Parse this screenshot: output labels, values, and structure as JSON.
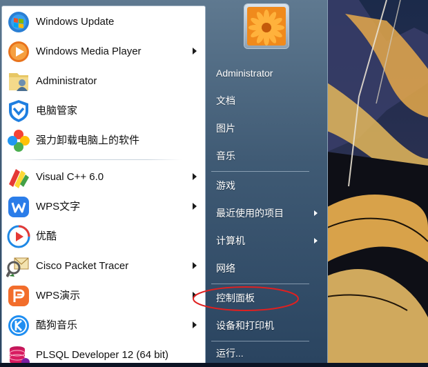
{
  "start_menu": {
    "programs": [
      {
        "label": "Windows Update",
        "icon": "windows-update-icon",
        "has_submenu": false
      },
      {
        "label": "Windows Media Player",
        "icon": "media-player-icon",
        "has_submenu": true
      },
      {
        "label": "Administrator",
        "icon": "user-folder-icon",
        "has_submenu": false
      },
      {
        "label": "电脑管家",
        "icon": "tencent-pc-manager-icon",
        "has_submenu": false
      },
      {
        "label": "强力卸载电脑上的软件",
        "icon": "uninstaller-icon",
        "has_submenu": false
      },
      {
        "label": "Visual C++ 6.0",
        "icon": "visual-cpp-icon",
        "has_submenu": true
      },
      {
        "label": "WPS文字",
        "icon": "wps-writer-icon",
        "has_submenu": true
      },
      {
        "label": "优酷",
        "icon": "youku-icon",
        "has_submenu": false
      },
      {
        "label": "Cisco Packet Tracer",
        "icon": "packet-tracer-icon",
        "has_submenu": true
      },
      {
        "label": "WPS演示",
        "icon": "wps-presentation-icon",
        "has_submenu": true
      },
      {
        "label": "酷狗音乐",
        "icon": "kugou-icon",
        "has_submenu": true
      },
      {
        "label": "PLSQL Developer 12 (64 bit)",
        "icon": "plsql-icon",
        "has_submenu": false
      }
    ],
    "right_links": [
      {
        "label": "Administrator",
        "has_submenu": false
      },
      {
        "label": "文档",
        "has_submenu": false
      },
      {
        "label": "图片",
        "has_submenu": false
      },
      {
        "label": "音乐",
        "has_submenu": false
      },
      {
        "label": "游戏",
        "has_submenu": false
      },
      {
        "label": "最近使用的项目",
        "has_submenu": true
      },
      {
        "label": "计算机",
        "has_submenu": true
      },
      {
        "label": "网络",
        "has_submenu": false
      },
      {
        "label": "控制面板",
        "has_submenu": false
      },
      {
        "label": "设备和打印机",
        "has_submenu": false
      },
      {
        "label": "运行...",
        "has_submenu": false
      }
    ],
    "user_picture": "flower-picture",
    "highlight": "控制面板",
    "highlight_color": "#e02020"
  }
}
